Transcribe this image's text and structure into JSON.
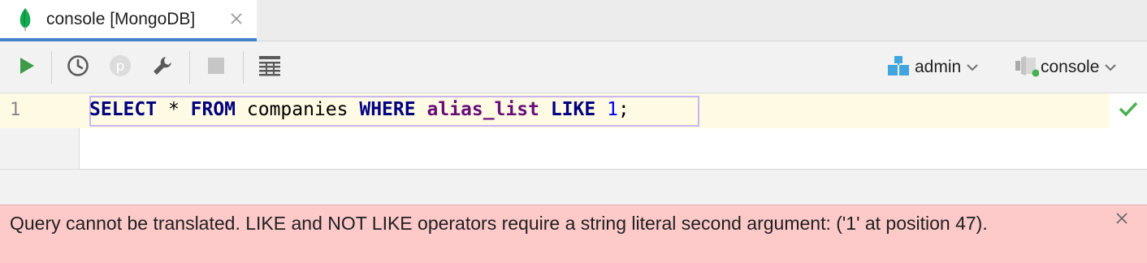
{
  "tab": {
    "title": "console [MongoDB]",
    "icon": "mongodb-leaf-icon"
  },
  "toolbar": {
    "buttons": [
      {
        "name": "run-button",
        "icon": "play-icon"
      },
      {
        "name": "history-button",
        "icon": "clock-icon"
      },
      {
        "name": "parameters-button",
        "icon": "p-icon"
      },
      {
        "name": "settings-button",
        "icon": "wrench-icon"
      },
      {
        "name": "stop-button",
        "icon": "stop-icon"
      },
      {
        "name": "output-layout-button",
        "icon": "table-icon"
      }
    ],
    "schema": {
      "label": "admin",
      "icon": "schema-icon"
    },
    "session": {
      "label": "console",
      "icon": "session-icon"
    }
  },
  "editor": {
    "line_number": "1",
    "tokens": {
      "kw_select": "SELECT",
      "star": " * ",
      "kw_from": "FROM",
      "table": " companies ",
      "kw_where": "WHERE",
      "sp1": " ",
      "column": "alias_list",
      "sp2": " ",
      "kw_like": "LIKE",
      "sp3": " ",
      "number": "1",
      "semicolon": ";"
    }
  },
  "error": {
    "message": "Query cannot be translated. LIKE and NOT LIKE operators require a string literal second argument: ('1' at position 47)."
  },
  "colors": {
    "accent": "#4083c9",
    "run_green": "#3c9a48",
    "error_bg": "#fdc9c9",
    "current_line": "#fffae3",
    "keyword": "#000080",
    "column": "#660e7a",
    "number": "#0000ff"
  }
}
